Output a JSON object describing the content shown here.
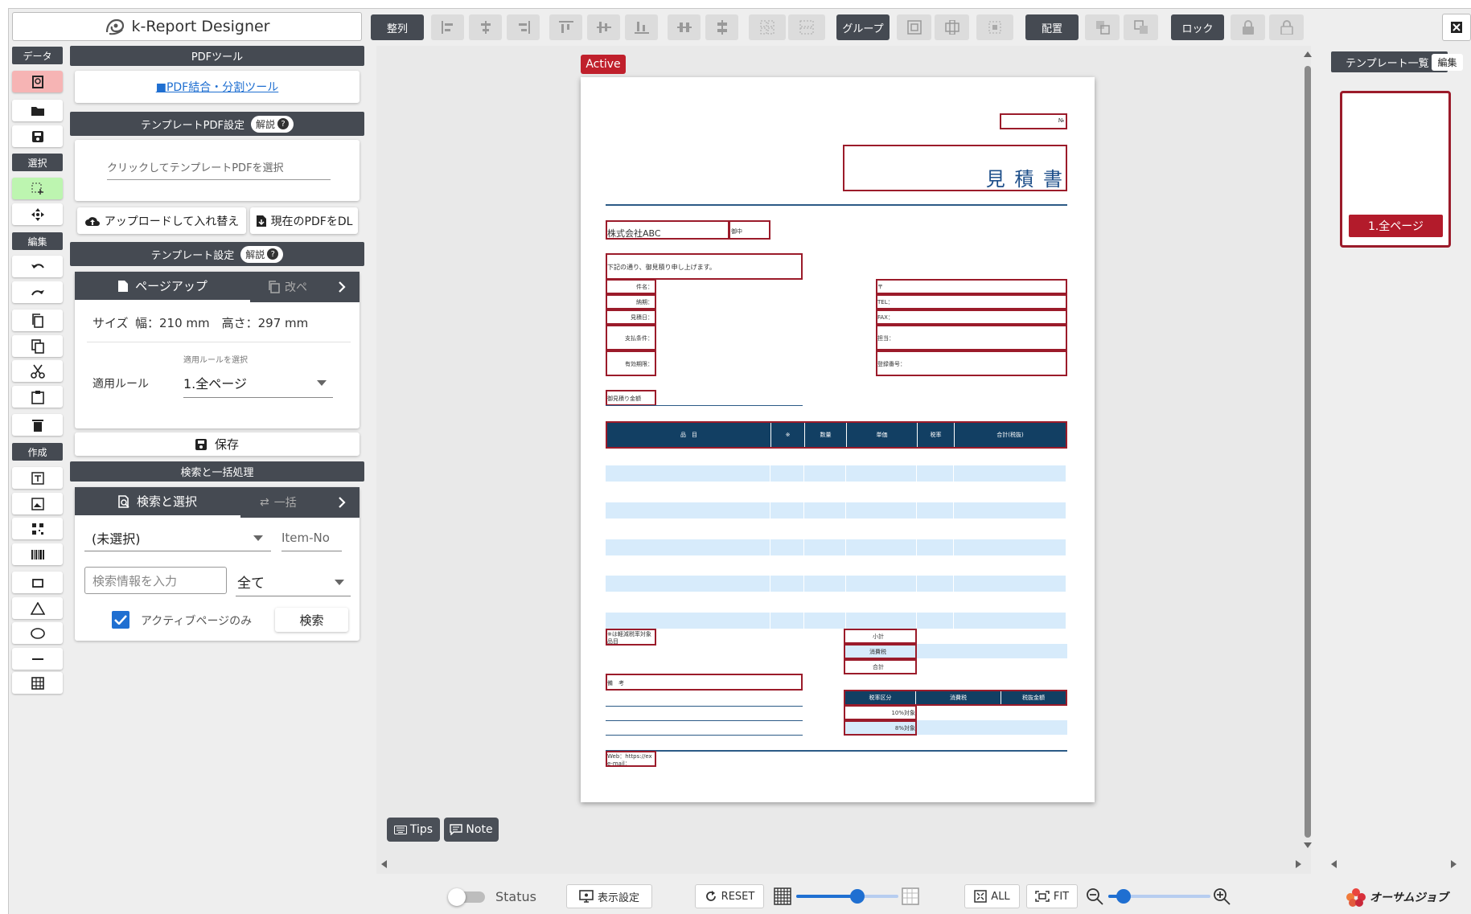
{
  "app": {
    "title": "k-Report Designer"
  },
  "toolbar": {
    "align": "整列",
    "group": "グループ",
    "arrange": "配置",
    "lock": "ロック"
  },
  "left_sections": {
    "data": "データ",
    "select": "選択",
    "edit": "編集",
    "create": "作成"
  },
  "pdf_tools": {
    "header": "PDFツール",
    "link": "■PDF結合・分割ツール",
    "template_pdf_header": "テンプレートPDF設定",
    "help": "解説",
    "template_pdf_placeholder": "クリックしてテンプレートPDFを選択",
    "upload_replace": "アップロードして入れ替え",
    "download_current": "現在のPDFをDL"
  },
  "template_settings": {
    "header": "テンプレート設定",
    "help": "解説",
    "tab_page_setup": "ページアップ",
    "tab_next": "改ペ",
    "size_label": "サイズ",
    "size_value": "幅：210 mm　高さ：297 mm",
    "rule_label": "適用ルール",
    "rule_caption": "適用ルールを選択",
    "rule_value": "1.全ページ",
    "save": "保存"
  },
  "search": {
    "header": "検索と一括処理",
    "tab_search": "検索と選択",
    "tab_bulk": "一括",
    "select_value": "(未選択)",
    "item_no": "Item-No",
    "input_placeholder": "検索情報を入力",
    "scope_value": "全て",
    "active_only": "アクティブページのみ",
    "search_button": "検索"
  },
  "canvas": {
    "active_badge": "Active",
    "tips": "Tips",
    "note": "Note"
  },
  "document": {
    "title": "見 積 書",
    "no_label": "№",
    "customer": "株式会社ABC",
    "honorific": "御中",
    "intro": "下記の通り、御見積り申し上げます。",
    "left_fields": [
      "件名：",
      "納期：",
      "見積日：",
      "支払条件：",
      "有効期限："
    ],
    "right_fields": [
      "〒",
      "TEL：",
      "FAX：",
      "担当：",
      "登録番号："
    ],
    "amount_label": "御見積り金額",
    "table_headers": [
      "品　目",
      "※",
      "数量",
      "単価",
      "税率",
      "合計(税抜)"
    ],
    "reduced_note": "※は軽減税率対象品目",
    "subtotal": "小計",
    "tax": "消費税",
    "total": "合計",
    "remarks": "備　考",
    "tax_headers": [
      "税率区分",
      "消費税",
      "税抜金額"
    ],
    "tax_rows": [
      "10%対象",
      "8%対象"
    ],
    "web": "Web：https://ex",
    "mail": "e-mail："
  },
  "templates": {
    "header": "テンプレート一覧",
    "edit": "編集",
    "page_label": "1.全ページ"
  },
  "bottom": {
    "status": "Status",
    "display_settings": "表示設定",
    "reset": "RESET",
    "all": "ALL",
    "fit": "FIT",
    "brand": "オーサムジョブ"
  },
  "colors": {
    "accent_red": "#9b1b2a",
    "dark": "#454a52",
    "blue": "#1f6fd1",
    "table_header": "#123f63",
    "stripe": "#d7ebfb"
  }
}
